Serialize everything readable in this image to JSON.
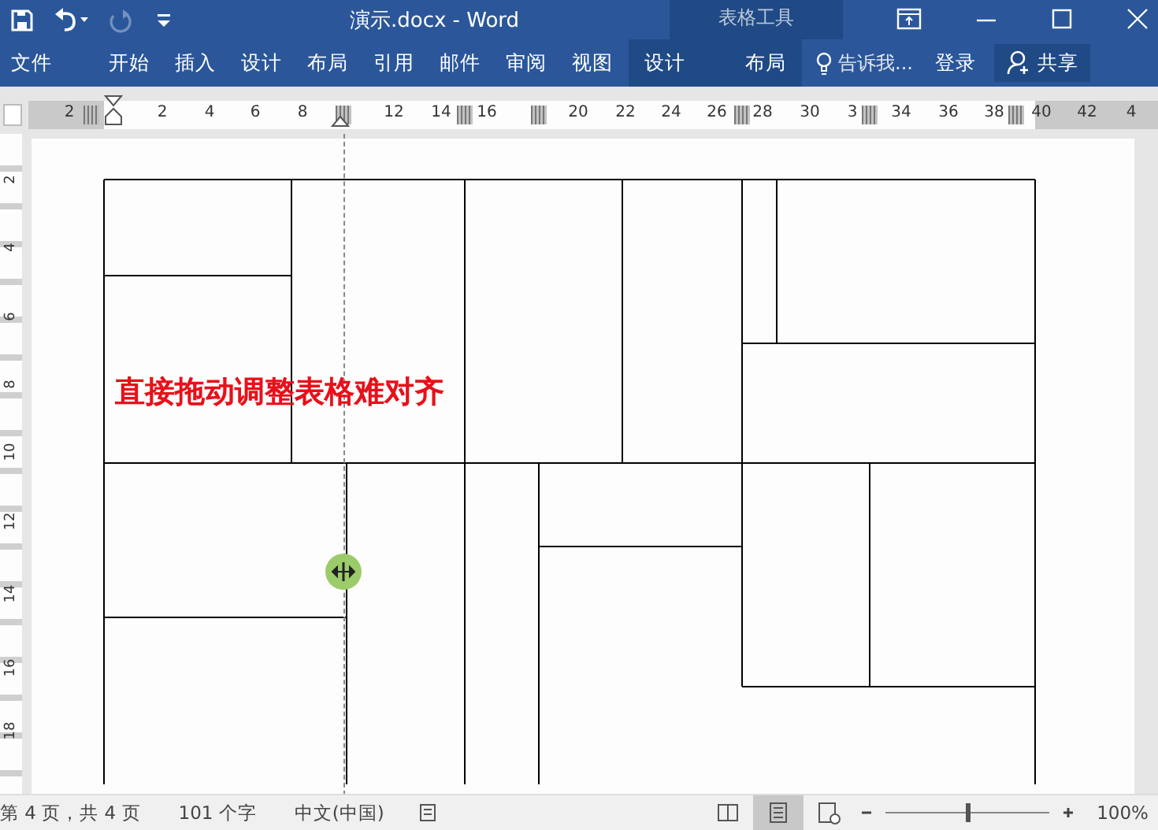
{
  "title_bar": {
    "title": "演示.docx - Word",
    "context_group": "表格工具",
    "quick_access": [
      {
        "kind": "save",
        "disabled": false
      },
      {
        "kind": "undo",
        "disabled": false
      },
      {
        "kind": "redo",
        "disabled": true
      },
      {
        "kind": "customize",
        "disabled": false
      }
    ]
  },
  "ribbon_tabs": [
    {
      "label": "文件",
      "contextual": false
    },
    {
      "label": "开始",
      "contextual": false
    },
    {
      "label": "插入",
      "contextual": false
    },
    {
      "label": "设计",
      "contextual": false
    },
    {
      "label": "布局",
      "contextual": false
    },
    {
      "label": "引用",
      "contextual": false
    },
    {
      "label": "邮件",
      "contextual": false
    },
    {
      "label": "审阅",
      "contextual": false
    },
    {
      "label": "视图",
      "contextual": false
    },
    {
      "label": "设计",
      "contextual": true
    },
    {
      "label": "布局",
      "contextual": true
    }
  ],
  "tell_me": "告诉我...",
  "sign_in": "登录",
  "share": "共享",
  "ruler": {
    "labels": [
      "2",
      "2",
      "4",
      "6",
      "8",
      "12",
      "14",
      "16",
      "20",
      "22",
      "24",
      "26",
      "28",
      "30",
      "3",
      "34",
      "36",
      "38",
      "40",
      "42",
      "4"
    ]
  },
  "vertical_ruler": {
    "labels": [
      "2",
      "4",
      "6",
      "8",
      "10",
      "12",
      "14",
      "16",
      "18"
    ]
  },
  "document": {
    "annotation": "直接拖动调整表格难对齐"
  },
  "status_bar": {
    "page": "第 4 页，共 4 页",
    "words": "101 个字",
    "language": "中文(中国)",
    "views": [
      {
        "kind": "read",
        "selected": false
      },
      {
        "kind": "print",
        "selected": true
      },
      {
        "kind": "web",
        "selected": false
      }
    ],
    "zoom": {
      "level": 0.5,
      "reading": "100%"
    }
  }
}
